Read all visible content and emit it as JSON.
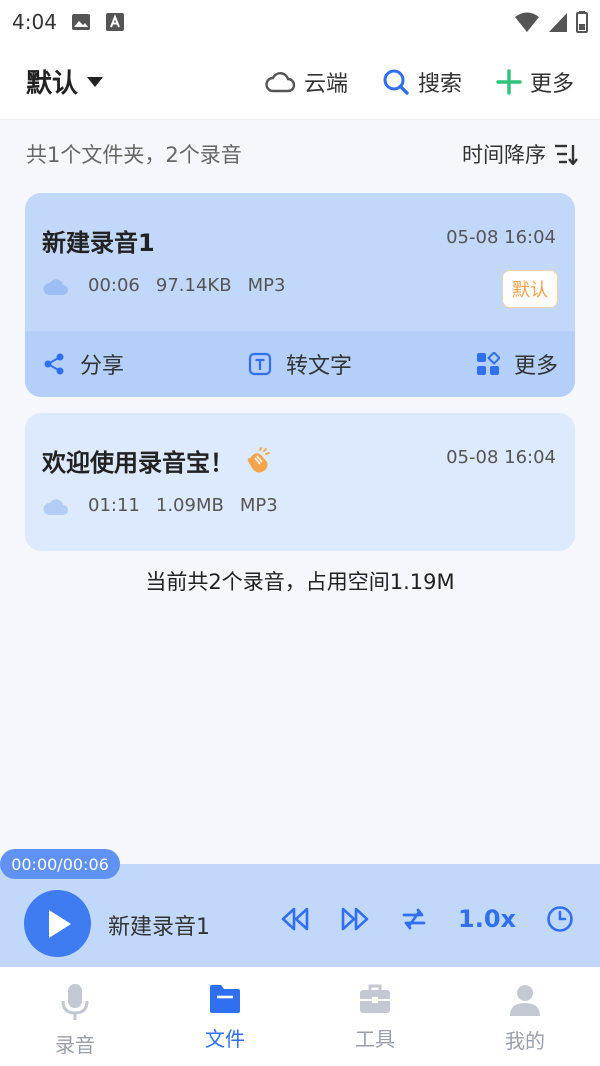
{
  "status_bar": {
    "time": "4:04"
  },
  "header": {
    "folder_title": "默认",
    "cloud_label": "云端",
    "search_label": "搜索",
    "more_label": "更多"
  },
  "summary": {
    "count_text": "共1个文件夹，2个录音",
    "sort_label": "时间降序"
  },
  "recordings": [
    {
      "title": "新建录音1",
      "date": "05-08 16:04",
      "duration": "00:06",
      "size": "97.14KB",
      "format": "MP3",
      "badge": "默认",
      "actions": {
        "share": "分享",
        "transcribe": "转文字",
        "more": "更多"
      }
    },
    {
      "title": "欢迎使用录音宝！",
      "date": "05-08 16:04",
      "duration": "01:11",
      "size": "1.09MB",
      "format": "MP3"
    }
  ],
  "footer_total": "当前共2个录音，占用空间1.19M",
  "player": {
    "time": "00:00/00:06",
    "title": "新建录音1",
    "speed": "1.0x"
  },
  "tabs": [
    {
      "label": "录音"
    },
    {
      "label": "文件"
    },
    {
      "label": "工具"
    },
    {
      "label": "我的"
    }
  ],
  "colors": {
    "accent": "#2f6ff0",
    "card_active": "#c2d8fb",
    "card": "#dde9fd",
    "badge_text": "#f2a04a"
  }
}
